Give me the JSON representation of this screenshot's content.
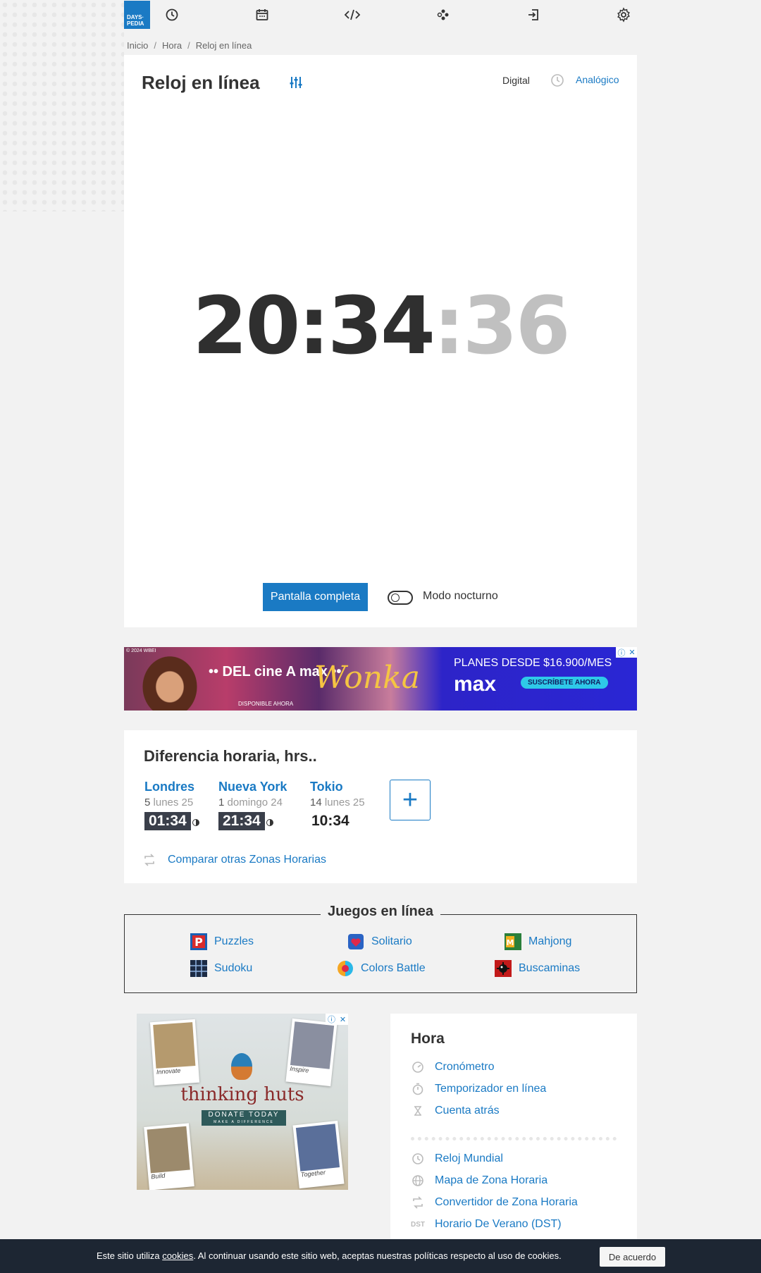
{
  "nav": {
    "logo_line1": "DAYS·",
    "logo_line2": "PEDIA",
    "icons": [
      "clock-icon",
      "calendar-icon",
      "code-icon",
      "games-icon",
      "login-icon",
      "gear-icon"
    ]
  },
  "breadcrumb": [
    "Inicio",
    "Hora",
    "Reloj en línea"
  ],
  "clock": {
    "title": "Reloj en línea",
    "mode_digital": "Digital",
    "mode_analog": "Analógico",
    "hours_minutes": "20:34",
    "seconds": ":36",
    "fullscreen_label": "Pantalla completa",
    "night_mode_label": "Modo nocturno",
    "night_mode_on": false
  },
  "ad_banner": {
    "copyright": "© 2024 WBEI",
    "text1": "•• DEL cine A max ••",
    "available": "DISPONIBLE AHORA",
    "movie": "Wonka",
    "plans": "PLANES DESDE $16.900/MES",
    "brand": "max",
    "cta": "SUSCRÍBETE AHORA"
  },
  "time_difference": {
    "title": "Diferencia horaria, hrs..",
    "cities": [
      {
        "name": "Londres",
        "offset": "5",
        "day": "lunes 25",
        "time": "01:34",
        "night": true
      },
      {
        "name": "Nueva York",
        "offset": "1",
        "day": "domingo 24",
        "time": "21:34",
        "night": true
      },
      {
        "name": "Tokio",
        "offset": "14",
        "day": "lunes 25",
        "time": "10:34",
        "night": false
      }
    ],
    "add_label": "+",
    "compare_label": "Comparar otras Zonas Horarias"
  },
  "games": {
    "title": "Juegos en línea",
    "items": [
      "Puzzles",
      "Solitario",
      "Mahjong",
      "Sudoku",
      "Colors Battle",
      "Buscaminas"
    ]
  },
  "ad_square": {
    "brand": "thinking huts",
    "donate": "DONATE TODAY",
    "donate_sub": "MAKE A DIFFERENCE",
    "captions": [
      "Innovate",
      "Inspire",
      "Build",
      "Together"
    ]
  },
  "hora": {
    "title": "Hora",
    "links_top": [
      "Cronómetro",
      "Temporizador en línea",
      "Cuenta atrás"
    ],
    "links_bottom": [
      "Reloj Mundial",
      "Mapa de Zona Horaria",
      "Convertidor de Zona Horaria",
      "Horario De Verano (DST)"
    ],
    "dst_badge": "DST"
  },
  "cookie": {
    "text_before": "Este sitio utiliza ",
    "link": "cookies",
    "text_after": ". Al continuar usando este sitio web, aceptas nuestras políticas respecto al uso de cookies.",
    "button": "De acuerdo"
  },
  "colors": {
    "accent": "#1a7ac4",
    "dark_time_bg": "#3a3f4a",
    "cookie_bg": "#1d2633"
  }
}
